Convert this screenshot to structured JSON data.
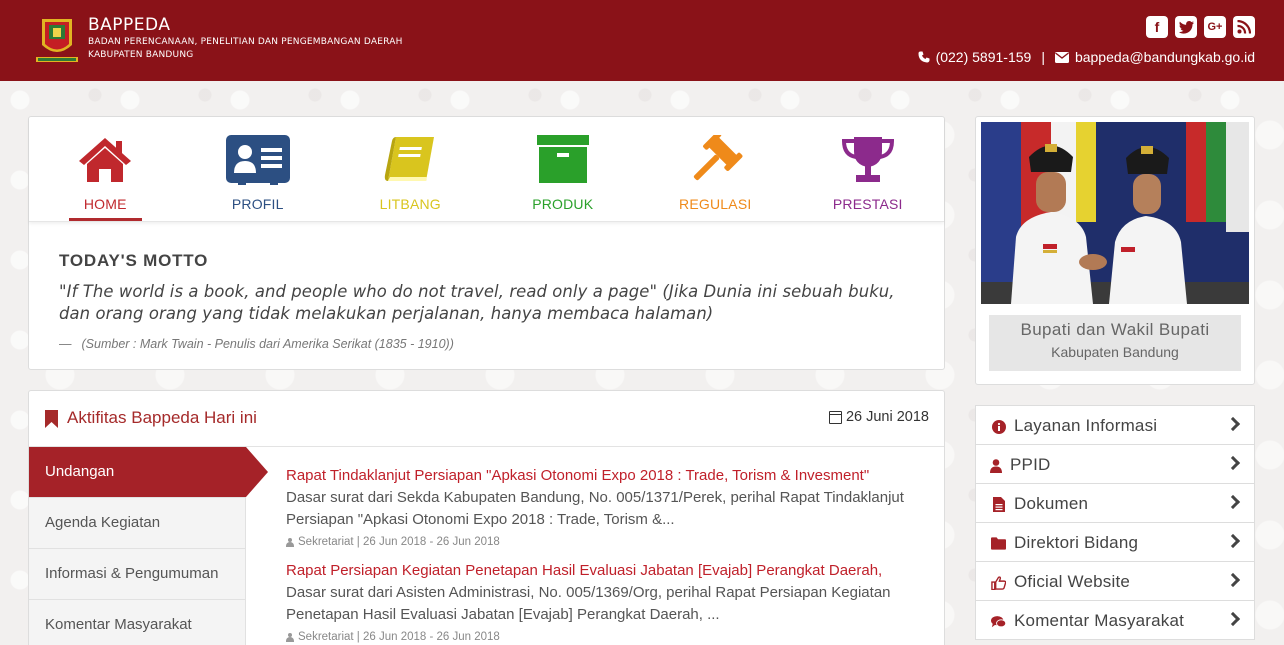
{
  "header": {
    "brand_name": "BAPPEDA",
    "brand_sub_1": "BADAN PERENCANAAN, PENELITIAN DAN PENGEMBANGAN DAERAH",
    "brand_sub_2": "KABUPATEN BANDUNG",
    "phone": "(022) 5891-159",
    "separator": "|",
    "email": "bappeda@bandungkab.go.id",
    "social": [
      {
        "icon": "facebook-icon",
        "glyph": "f"
      },
      {
        "icon": "twitter-icon",
        "glyph": "t"
      },
      {
        "icon": "google-plus-icon",
        "glyph": "G+"
      },
      {
        "icon": "rss-icon",
        "glyph": "∵"
      }
    ],
    "colors": {
      "bar": "#8a1218"
    }
  },
  "nav": {
    "items": [
      {
        "label": "HOME",
        "icon": "home-icon",
        "color": "#c0282d",
        "active": true
      },
      {
        "label": "PROFIL",
        "icon": "id-card-icon",
        "color": "#2c4f82",
        "active": false
      },
      {
        "label": "LITBANG",
        "icon": "book-icon",
        "color": "#d9c51e",
        "active": false
      },
      {
        "label": "PRODUK",
        "icon": "archive-box-icon",
        "color": "#2aa02a",
        "active": false
      },
      {
        "label": "REGULASI",
        "icon": "gavel-icon",
        "color": "#ef8a1a",
        "active": false
      },
      {
        "label": "PRESTASI",
        "icon": "trophy-icon",
        "color": "#8c2a8c",
        "active": false
      }
    ]
  },
  "motto": {
    "title": "TODAY'S MOTTO",
    "text": "\"If The world is a book, and people who do not travel, read only a page\" (Jika Dunia ini sebuah buku, dan orang orang yang tidak melakukan perjalanan, hanya membaca halaman)",
    "dash": "—",
    "source": "(Sumber : Mark Twain - Penulis dari Amerika Serikat (1835 - 1910))"
  },
  "activities": {
    "title": "Aktifitas Bappeda Hari ini",
    "date": "26 Juni 2018",
    "tabs": [
      {
        "label": "Undangan",
        "active": true
      },
      {
        "label": "Agenda Kegiatan",
        "active": false
      },
      {
        "label": "Informasi & Pengumuman",
        "active": false
      },
      {
        "label": "Komentar Masyarakat",
        "active": false
      }
    ],
    "items": [
      {
        "title": "Rapat Tindaklanjut Persiapan \"Apkasi Otonomi Expo 2018 : Trade, Torism & Invesment\"",
        "desc": "Dasar surat dari Sekda Kabupaten Bandung, No. 005/1371/Perek, perihal Rapat Tindaklanjut Persiapan \"Apkasi Otonomi Expo 2018 : Trade, Torism &...",
        "meta": "Sekretariat | 26 Jun 2018 - 26 Jun 2018"
      },
      {
        "title": "Rapat Persiapan Kegiatan Penetapan Hasil Evaluasi Jabatan [Evajab] Perangkat Daerah,",
        "desc": "Dasar surat dari Asisten Administrasi, No. 005/1369/Org, perihal Rapat Persiapan Kegiatan Penetapan Hasil Evaluasi Jabatan [Evajab] Perangkat Daerah, ...",
        "meta": "Sekretariat | 26 Jun 2018 - 26 Jun 2018"
      }
    ]
  },
  "profile": {
    "caption_title": "Bupati dan Wakil Bupati",
    "caption_sub": "Kabupaten Bandung"
  },
  "side_menu": [
    {
      "label": "Layanan Informasi",
      "icon": "info-circle-icon"
    },
    {
      "label": "PPID",
      "icon": "user-icon"
    },
    {
      "label": "Dokumen",
      "icon": "file-icon"
    },
    {
      "label": "Direktori Bidang",
      "icon": "folder-icon"
    },
    {
      "label": "Oficial Website",
      "icon": "thumbs-up-icon"
    },
    {
      "label": "Komentar Masyarakat",
      "icon": "comments-icon"
    }
  ]
}
